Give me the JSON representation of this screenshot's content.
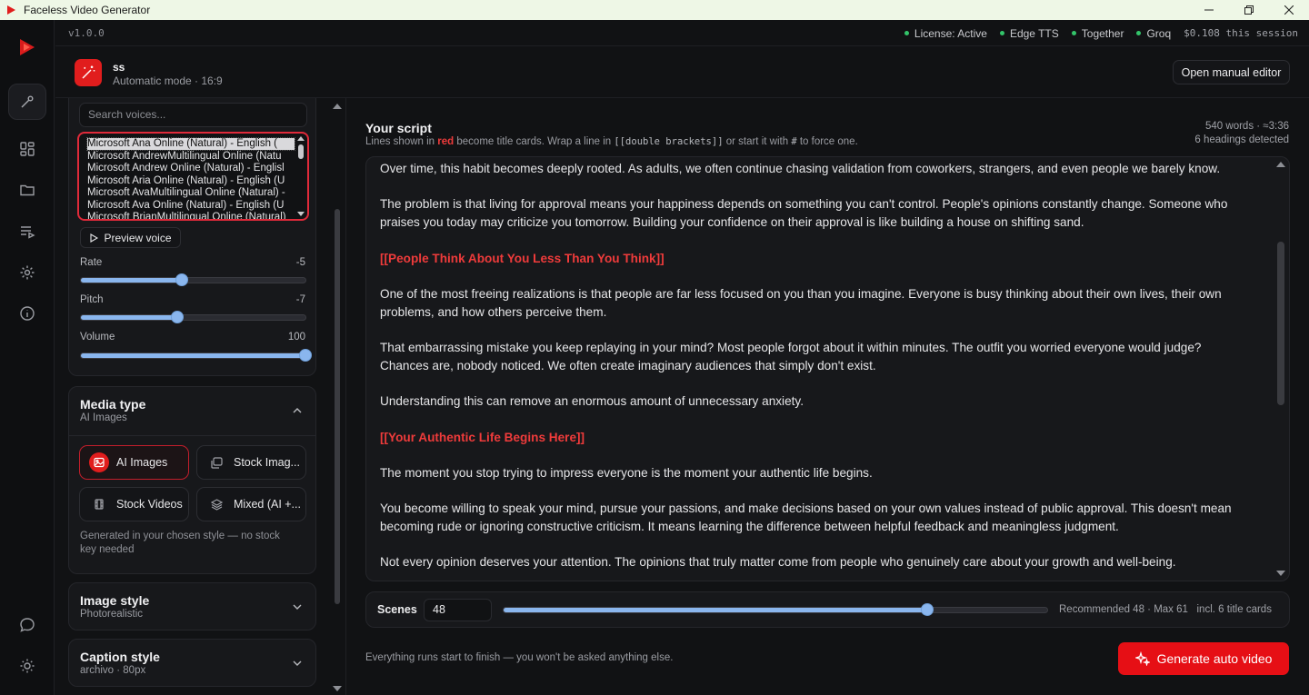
{
  "window": {
    "title": "Faceless Video Generator"
  },
  "topbar": {
    "version": "v1.0.0",
    "status": [
      "License: Active",
      "Edge TTS",
      "Together",
      "Groq"
    ],
    "cost": "$0.108 this session"
  },
  "project": {
    "name": "ss",
    "mode": "Automatic mode · 16:9",
    "manual_editor_label": "Open manual editor"
  },
  "voice": {
    "search_placeholder": "Search voices...",
    "options": [
      "Microsoft Ana Online (Natural) - English (",
      "Microsoft AndrewMultilingual Online (Natu",
      "Microsoft Andrew Online (Natural) - Englisl",
      "Microsoft Aria Online (Natural) - English (U",
      "Microsoft AvaMultilingual Online (Natural) -",
      "Microsoft Ava Online (Natural) - English (U",
      "Microsoft BrianMultilingual Online (Natural)"
    ],
    "selected_index": 0,
    "preview_label": "Preview voice",
    "rate": {
      "label": "Rate",
      "value": "-5",
      "fraction": 0.45
    },
    "pitch": {
      "label": "Pitch",
      "value": "-7",
      "fraction": 0.43
    },
    "volume": {
      "label": "Volume",
      "value": "100",
      "fraction": 1.0
    }
  },
  "media": {
    "title": "Media type",
    "subtitle": "AI Images",
    "options": [
      "AI Images",
      "Stock Imag...",
      "Stock Videos",
      "Mixed (AI +..."
    ],
    "selected": "AI Images",
    "note": "Generated in your chosen style — no stock key needed"
  },
  "image_style": {
    "title": "Image style",
    "subtitle": "Photorealistic"
  },
  "caption_style": {
    "title": "Caption style",
    "subtitle": "archivo · 80px"
  },
  "script": {
    "title": "Your script",
    "hint_prefix": "Lines shown in",
    "hint_red": "red",
    "hint_mid": "become title cards. Wrap a line in",
    "hint_code": "[[double brackets]]",
    "hint_mid2": "or start it with",
    "hint_code2": "#",
    "hint_suffix": "to force one.",
    "word_count": "540 words · ≈3:36",
    "headings_detected": "6 headings detected",
    "lines": [
      {
        "text": "Over time, this habit becomes deeply rooted. As adults, we often continue chasing validation from coworkers, strangers, and even people we barely know.",
        "heading": false
      },
      {
        "text": "The problem is that living for approval means your happiness depends on something you can't control. People's opinions constantly change. Someone who",
        "heading": false
      },
      {
        "text": "praises you today may criticize you tomorrow. Building your confidence on their approval is like building a house on shifting sand.",
        "heading": false
      },
      {
        "text": "[[People Think About You Less Than You Think]]",
        "heading": true
      },
      {
        "text": "One of the most freeing realizations is that people are far less focused on you than you imagine. Everyone is busy thinking about their own lives, their own",
        "heading": false
      },
      {
        "text": "problems, and how others perceive them.",
        "heading": false
      },
      {
        "text": "That embarrassing mistake you keep replaying in your mind? Most people forgot about it within minutes. The outfit you worried everyone would judge?",
        "heading": false
      },
      {
        "text": "Chances are, nobody noticed. We often create imaginary audiences that simply don't exist.",
        "heading": false
      },
      {
        "text": "Understanding this can remove an enormous amount of unnecessary anxiety.",
        "heading": false
      },
      {
        "text": "[[Your Authentic Life Begins Here]]",
        "heading": true
      },
      {
        "text": "The moment you stop trying to impress everyone is the moment your authentic life begins.",
        "heading": false
      },
      {
        "text": "You become willing to speak your mind, pursue your passions, and make decisions based on your own values instead of public approval. This doesn't mean",
        "heading": false
      },
      {
        "text": "becoming rude or ignoring constructive criticism. It means learning the difference between helpful feedback and meaningless judgment.",
        "heading": false
      },
      {
        "text": "Not every opinion deserves your attention. The opinions that truly matter come from people who genuinely care about your growth and well-being.",
        "heading": false
      }
    ]
  },
  "scenes": {
    "label": "Scenes",
    "value": "48",
    "fraction": 0.78,
    "recommendation": "Recommended 48 · Max 61",
    "title_cards": "incl. 6 title cards"
  },
  "footer": {
    "note": "Everything runs start to finish — you won't be asked anything else.",
    "generate_label": "Generate auto video"
  },
  "colors": {
    "accent": "#e11d1d",
    "slider": "#8ab6ee",
    "status_dot": "#33c46a",
    "heading": "#ef3b3b"
  }
}
